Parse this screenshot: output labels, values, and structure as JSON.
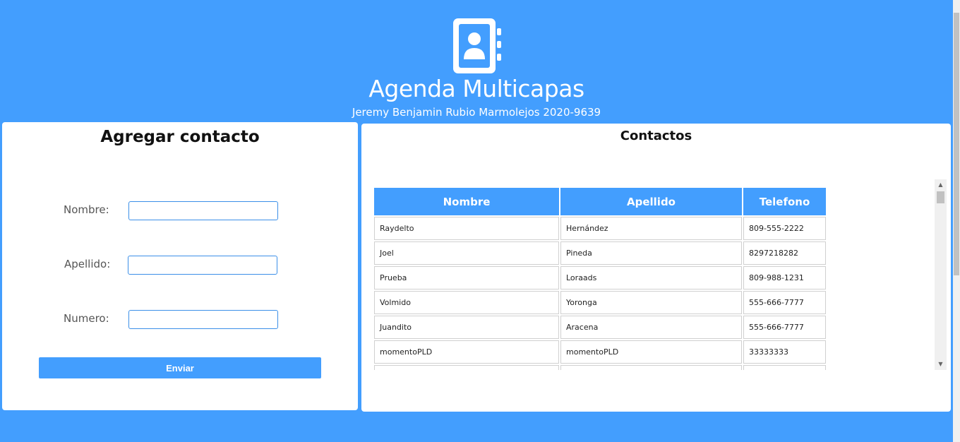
{
  "header": {
    "logo_icon": "contact-book-icon",
    "title": "Agenda Multicapas",
    "subtitle": "Jeremy Benjamin Rubio Marmolejos 2020-9639"
  },
  "add_contact": {
    "title": "Agregar contacto",
    "fields": [
      {
        "label": "Nombre:",
        "value": "",
        "placeholder": ""
      },
      {
        "label": "Apellido:",
        "value": "",
        "placeholder": ""
      },
      {
        "label": "Numero:",
        "value": "",
        "placeholder": ""
      }
    ],
    "submit_label": "Enviar"
  },
  "contacts": {
    "title": "Contactos",
    "columns": [
      "Nombre",
      "Apellido",
      "Telefono"
    ],
    "rows": [
      [
        "Raydelto",
        "Hernández",
        "809-555-2222"
      ],
      [
        "Joel",
        "Pineda",
        "8297218282"
      ],
      [
        "Prueba",
        "Loraads",
        "809-988-1231"
      ],
      [
        "Volmido",
        "Yoronga",
        "555-666-7777"
      ],
      [
        "Juandito",
        "Aracena",
        "555-666-7777"
      ],
      [
        "momentoPLD",
        "momentoPLD",
        "33333333"
      ],
      [
        "",
        "",
        ""
      ]
    ]
  },
  "colors": {
    "accent": "#439efe",
    "panel_bg": "#ffffff"
  }
}
